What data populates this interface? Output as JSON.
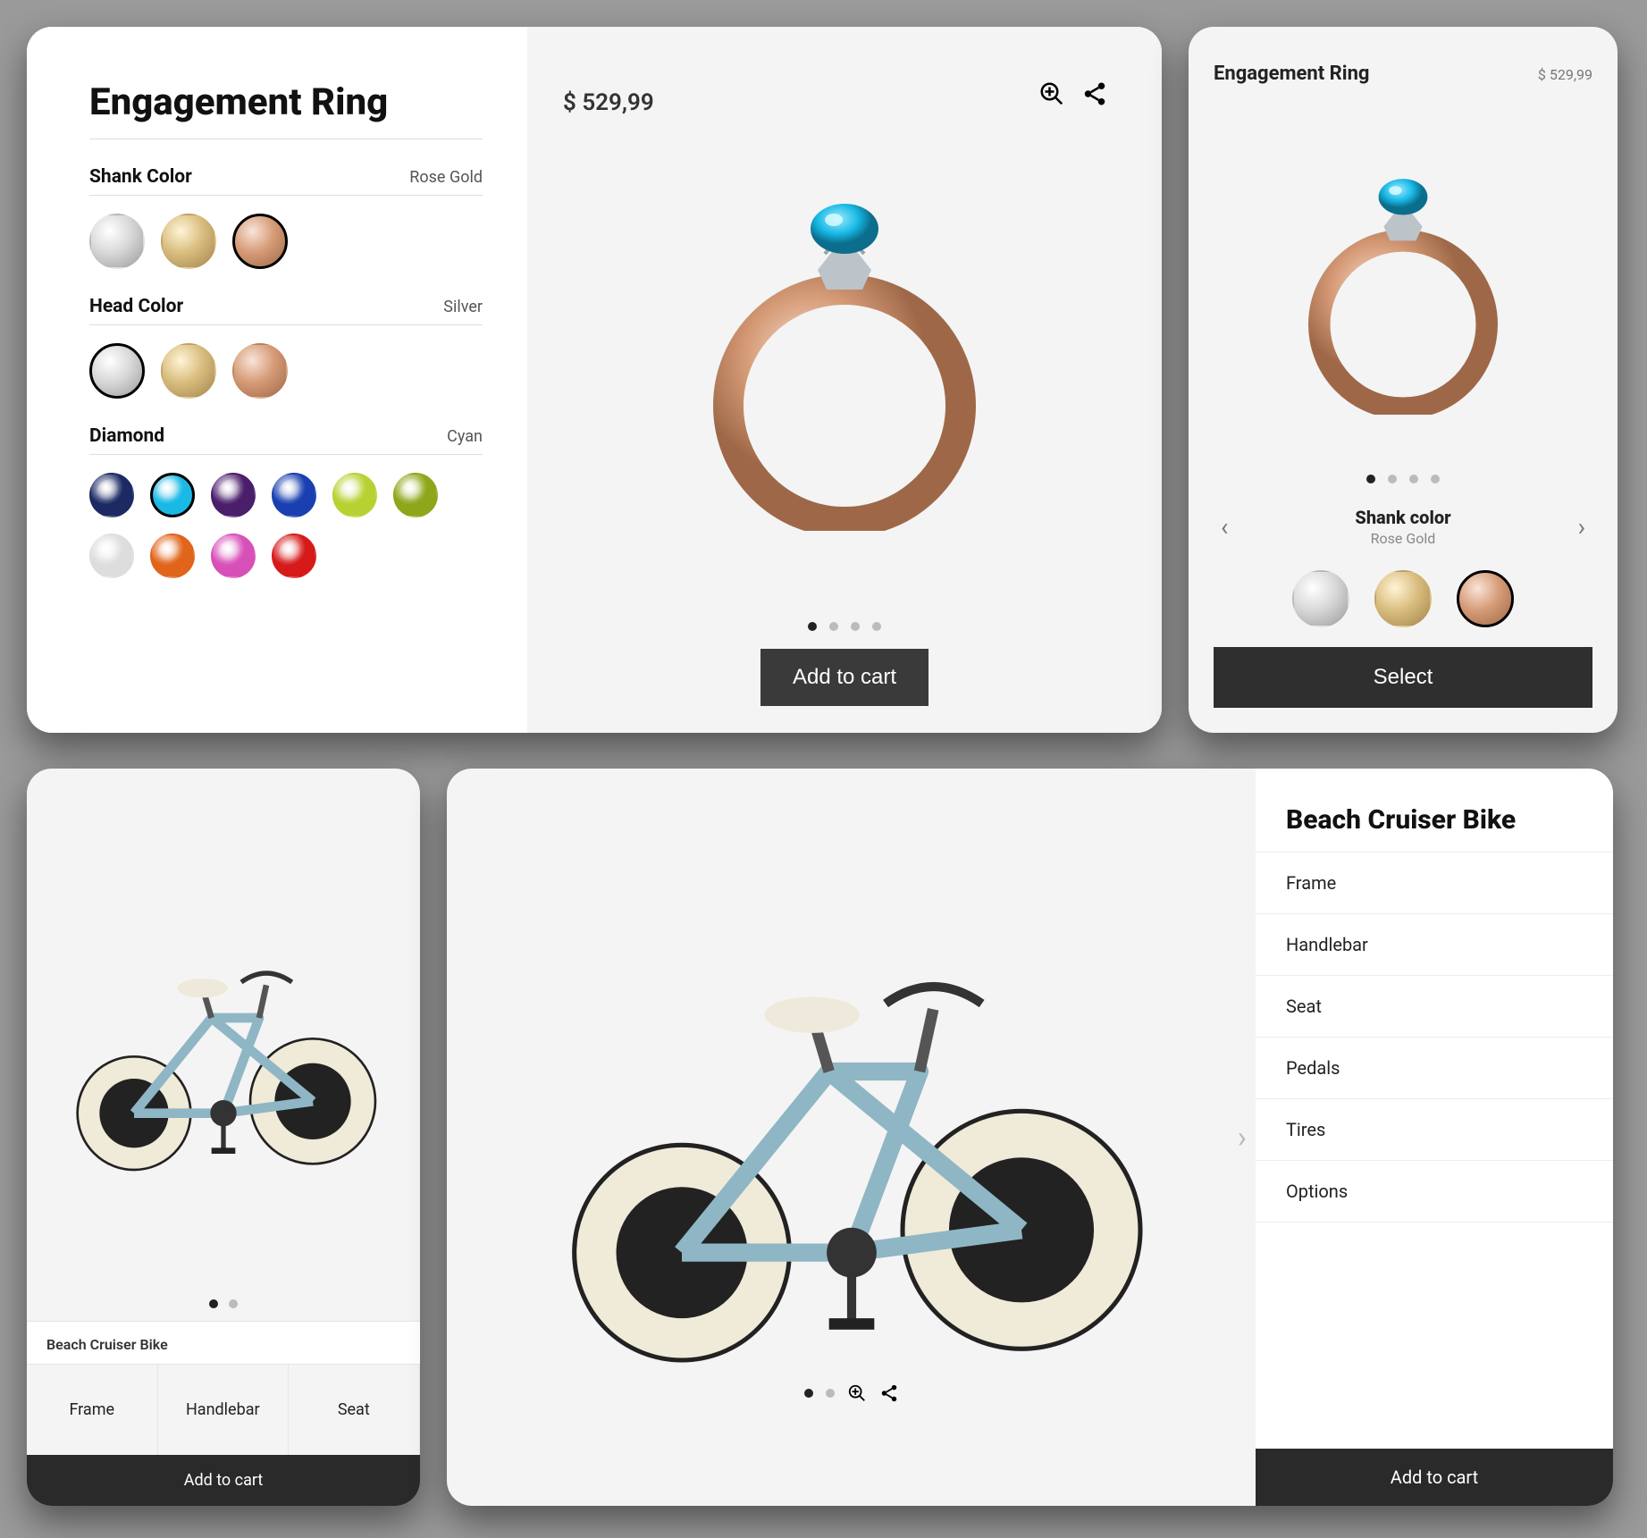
{
  "ring": {
    "title": "Engagement Ring",
    "price": "$ 529,99",
    "add_to_cart": "Add to cart",
    "select": "Select",
    "colors": {
      "silver": "radial-gradient(circle at 35% 30%, #fff, #d8d8d8 45%, #9a9a9a)",
      "gold": "radial-gradient(circle at 35% 30%, #fff4d6, #d9bd7f 45%, #a3854a)",
      "rose": "radial-gradient(circle at 35% 30%, #f8e4d8, #d69b77 45%, #9e6848)"
    },
    "options": {
      "shank": {
        "label": "Shank Color",
        "value": "Rose Gold",
        "items": [
          "silver",
          "gold",
          "rose"
        ],
        "selected": "rose"
      },
      "head": {
        "label": "Head Color",
        "value": "Silver",
        "items": [
          "silver",
          "gold",
          "rose"
        ],
        "selected": "silver"
      },
      "diamond": {
        "label": "Diamond",
        "value": "Cyan",
        "items": [
          {
            "name": "navy",
            "color": "#1b2a63"
          },
          {
            "name": "cyan",
            "color": "#19b9e6",
            "selected": true
          },
          {
            "name": "purple",
            "color": "#4a1e6b"
          },
          {
            "name": "blue",
            "color": "#1a3fb0"
          },
          {
            "name": "lime",
            "color": "#b8d132"
          },
          {
            "name": "olive",
            "color": "#8da71a"
          },
          {
            "name": "clear",
            "color": "#dddddd"
          },
          {
            "name": "orange",
            "color": "#e0641a"
          },
          {
            "name": "pink",
            "color": "#d750b8"
          },
          {
            "name": "red",
            "color": "#d61a1a"
          }
        ]
      }
    },
    "mobile_option": {
      "label": "Shank color",
      "value": "Rose Gold"
    }
  },
  "bike": {
    "title": "Beach Cruiser Bike",
    "add_to_cart": "Add to cart",
    "sections": [
      "Frame",
      "Handlebar",
      "Seat",
      "Pedals",
      "Tires",
      "Options"
    ],
    "mobile_tabs": [
      "Frame",
      "Handlebar",
      "Seat"
    ]
  }
}
